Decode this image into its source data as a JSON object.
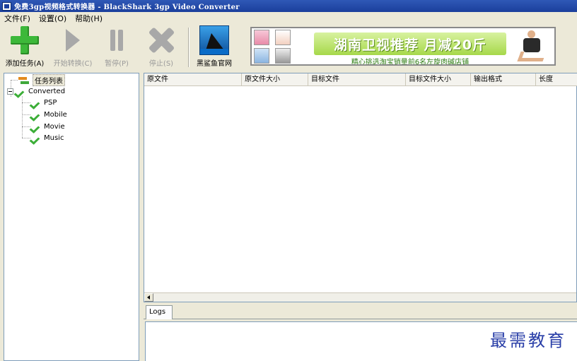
{
  "window": {
    "title": "免费3gp视频格式转换器 - BlackShark 3gp Video Converter"
  },
  "menu": [
    {
      "label": "文件(F)"
    },
    {
      "label": "设置(O)"
    },
    {
      "label": "帮助(H)"
    }
  ],
  "toolbar": {
    "add_task": "添加任务(A)",
    "start_convert": "开始转换(C)",
    "pause": "暂停(P)",
    "stop": "停止(S)",
    "website": "黑鲨鱼官网"
  },
  "ad": {
    "headline": "湖南卫视推荐 月减20斤",
    "subline": "精心挑选淘宝销量前6名左旋肉碱店铺"
  },
  "tree": {
    "root": "任务列表",
    "converted": "Converted",
    "children": [
      "PSP",
      "Mobile",
      "Movie",
      "Music"
    ]
  },
  "list": {
    "columns": [
      "原文件",
      "原文件大小",
      "目标文件",
      "目标文件大小",
      "输出格式",
      "长度"
    ]
  },
  "logs": {
    "tab": "Logs"
  },
  "watermark": "最需教育"
}
